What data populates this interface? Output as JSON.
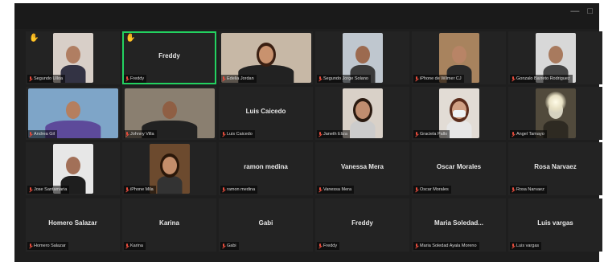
{
  "window": {
    "minimize": "—",
    "maximize": "□"
  },
  "tiles": [
    {
      "name": "Segundo Ulloa",
      "center": "",
      "hand": true,
      "video": true,
      "bg": "#d8cfc8",
      "skin": "#b07e62",
      "shirt": "#334"
    },
    {
      "name": "Freddy",
      "center": "Freddy",
      "hand": true,
      "video": false,
      "active": true
    },
    {
      "name": "Edelia Jordan",
      "center": "",
      "hand": false,
      "video": true,
      "wide": true,
      "bg": "#c7b8a6",
      "skin": "#c9926e",
      "shirt": "#222",
      "hair": "#3a1f12"
    },
    {
      "name": "Segundo Jorge Solano",
      "center": "",
      "hand": false,
      "video": true,
      "bg": "#bfc7cf",
      "skin": "#9c6a4f",
      "shirt": "#3b3b3b"
    },
    {
      "name": "iPhone de Wilmer CJ",
      "center": "",
      "hand": false,
      "video": true,
      "bg": "#a8835e",
      "skin": "#b88466",
      "shirt": "#2a2a2a"
    },
    {
      "name": "Gonzalo Barreto Rodriguez",
      "center": "",
      "hand": false,
      "video": true,
      "bg": "#d8d8d8",
      "skin": "#a87a5e",
      "shirt": "#444"
    },
    {
      "name": "Andrea Gil",
      "center": "",
      "hand": false,
      "video": true,
      "wide": true,
      "bg": "#7ea5c8",
      "skin": "#b57f5f",
      "shirt": "#5d4a9a"
    },
    {
      "name": "Johnny Villa",
      "center": "",
      "hand": false,
      "video": true,
      "wide": true,
      "bg": "#8a7f70",
      "skin": "#8f5f44",
      "shirt": "#222"
    },
    {
      "name": "Luis Caicedo",
      "center": "Luis Caicedo",
      "hand": false,
      "video": false
    },
    {
      "name": "Janeth Eliza",
      "center": "",
      "hand": false,
      "video": true,
      "bg": "#d9d1c8",
      "skin": "#c08d6f",
      "shirt": "#ccc",
      "hair": "#2a1a10"
    },
    {
      "name": "Graciela Pallo",
      "center": "",
      "hand": false,
      "video": true,
      "bg": "#e2dcd5",
      "skin": "#d0a084",
      "shirt": "#e7e7e7",
      "hair": "#5a2c1c",
      "mask": true
    },
    {
      "name": "Angel Tamayo",
      "center": "",
      "hand": false,
      "video": true,
      "bg": "#514a3c",
      "skin": "#d6d2c0",
      "shirt": "#2e2a22",
      "glow": true
    },
    {
      "name": "Jose Santamaria",
      "center": "",
      "hand": false,
      "video": true,
      "bg": "#e7e7e7",
      "skin": "#a27058",
      "shirt": "#1e1e1e"
    },
    {
      "name": "iPhone Mila",
      "center": "",
      "hand": false,
      "video": true,
      "bg": "#6c4a2e",
      "skin": "#c48e6b",
      "shirt": "#333",
      "hair": "#2a1709"
    },
    {
      "name": "ramon medina",
      "center": "ramon medina",
      "hand": false,
      "video": false
    },
    {
      "name": "Vanessa Mera",
      "center": "Vanessa Mera",
      "hand": false,
      "video": false
    },
    {
      "name": "Oscar Morales",
      "center": "Oscar Morales",
      "hand": false,
      "video": false
    },
    {
      "name": "Rosa Narvaez",
      "center": "Rosa Narvaez",
      "hand": false,
      "video": false
    },
    {
      "name": "Homero Salazar",
      "center": "Homero Salazar",
      "hand": false,
      "video": false
    },
    {
      "name": "Karina",
      "center": "Karina",
      "hand": false,
      "video": false
    },
    {
      "name": "Gabi",
      "center": "Gabi",
      "hand": false,
      "video": false
    },
    {
      "name": "Freddy",
      "center": "Freddy",
      "hand": false,
      "video": false
    },
    {
      "name": "Maria Soledad Ayala Moreno",
      "center": "Maria Soledad...",
      "hand": false,
      "video": false
    },
    {
      "name": "Luis vargas",
      "center": "Luis vargas",
      "hand": false,
      "video": false
    }
  ]
}
